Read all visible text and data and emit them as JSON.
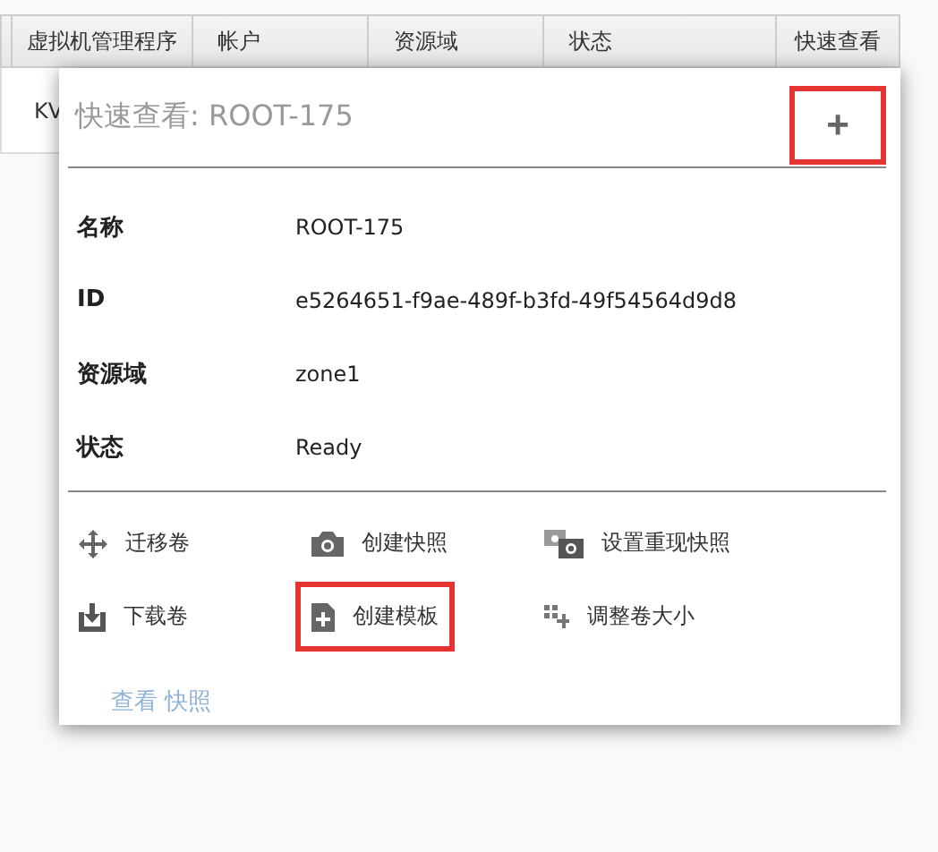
{
  "table": {
    "columns": [
      "虚拟机管理程序",
      "帐户",
      "资源域",
      "状态",
      "快速查看"
    ],
    "row_cell": "KV"
  },
  "quick_view": {
    "title": "快速查看: ROOT-175",
    "expand_button": {
      "label": "+",
      "highlighted": true
    },
    "details": [
      {
        "label": "名称",
        "value": "ROOT-175"
      },
      {
        "label": "ID",
        "value": "e5264651-f9ae-489f-b3fd-49f54564d9d8"
      },
      {
        "label": "资源域",
        "value": "zone1"
      },
      {
        "label": "状态",
        "value": "Ready"
      }
    ],
    "actions": [
      {
        "kind": "move",
        "label": "迁移卷",
        "highlighted": false
      },
      {
        "kind": "camera",
        "label": "创建快照",
        "highlighted": false
      },
      {
        "kind": "cameras",
        "label": "设置重现快照",
        "highlighted": false
      },
      {
        "kind": "download",
        "label": "下载卷",
        "highlighted": false
      },
      {
        "kind": "template",
        "label": "创建模板",
        "highlighted": true
      },
      {
        "kind": "resize",
        "label": "调整卷大小",
        "highlighted": false
      }
    ],
    "link": "查看 快照"
  }
}
